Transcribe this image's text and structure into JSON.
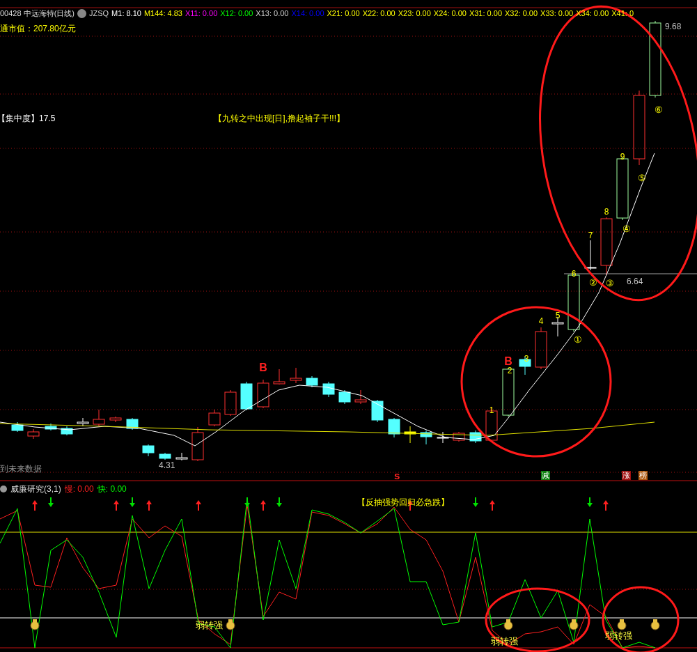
{
  "header": {
    "security": "00428 中远海特(日线)",
    "indicators": [
      {
        "text": "JZSQ",
        "color": "#d0d0d0"
      },
      {
        "text": "M1: 8.10",
        "color": "#ffffff"
      },
      {
        "text": "M144: 4.83",
        "color": "#ffff00"
      },
      {
        "text": "X11: 0.00",
        "color": "#ff00ff"
      },
      {
        "text": "X12: 0.00",
        "color": "#00ff00"
      },
      {
        "text": "X13: 0.00",
        "color": "#d0d0d0"
      },
      {
        "text": "X14: 0.00",
        "color": "#0000ff"
      },
      {
        "text": "X21: 0.00",
        "color": "#ffff00"
      },
      {
        "text": "X22: 0.00",
        "color": "#ffff00"
      },
      {
        "text": "X23: 0.00",
        "color": "#ffff00"
      },
      {
        "text": "X24: 0.00",
        "color": "#ffff00"
      },
      {
        "text": "X31: 0.00",
        "color": "#ffff00"
      },
      {
        "text": "X32: 0.00",
        "color": "#ffff00"
      },
      {
        "text": "X33: 0.00",
        "color": "#ffff00"
      },
      {
        "text": "X34: 0.00",
        "color": "#ffff00"
      },
      {
        "text": "X41: 0",
        "color": "#ffff00"
      }
    ],
    "market_cap": "通市值：207.80亿元"
  },
  "main_chart": {
    "concentration": "【集中度】17.5",
    "signal": "【九转之中出现[日],撸起袖子干!!!】",
    "future_note": "到未来数据",
    "candle_labels": [
      {
        "text": "B",
        "kind": "buy"
      },
      {
        "text": "1",
        "kind": "count"
      },
      {
        "text": "B",
        "kind": "buy"
      },
      {
        "text": "2",
        "kind": "count"
      },
      {
        "text": "3",
        "kind": "count"
      },
      {
        "text": "4",
        "kind": "count"
      },
      {
        "text": "5",
        "kind": "count"
      },
      {
        "text": "6",
        "kind": "count"
      },
      {
        "text": "7",
        "kind": "count"
      },
      {
        "text": "8",
        "kind": "count"
      },
      {
        "text": "9",
        "kind": "count"
      },
      {
        "text": "①",
        "kind": "seq"
      },
      {
        "text": "②",
        "kind": "seq"
      },
      {
        "text": "③",
        "kind": "seq"
      },
      {
        "text": "④",
        "kind": "seq"
      },
      {
        "text": "⑤",
        "kind": "seq"
      },
      {
        "text": "⑥",
        "kind": "seq"
      }
    ],
    "price_labels": [
      "9.68",
      "4.31",
      "6.64"
    ],
    "marks": [
      {
        "text": "s",
        "color": "#ff2020"
      },
      {
        "text": "减",
        "color": "#108010"
      },
      {
        "text": "涨",
        "color": "#a01010"
      },
      {
        "text": "榜",
        "color": "#b05a10"
      }
    ]
  },
  "oscillator": {
    "title": "威廉研究(3,1)",
    "readings": [
      {
        "text": "慢: 0.00",
        "color": "#ff2020"
      },
      {
        "text": "快: 0.00",
        "color": "#00ff00"
      }
    ],
    "signal": "【反抽强势回归必急跌】",
    "arrows": [
      {
        "kind": "up"
      },
      {
        "kind": "down"
      },
      {
        "kind": "up"
      },
      {
        "kind": "down"
      },
      {
        "kind": "up"
      },
      {
        "kind": "up"
      },
      {
        "kind": "down"
      },
      {
        "kind": "up"
      },
      {
        "kind": "down"
      },
      {
        "kind": "up"
      },
      {
        "kind": "down"
      },
      {
        "kind": "up"
      },
      {
        "kind": "down"
      },
      {
        "kind": "up"
      }
    ],
    "labels": [
      "弱转强",
      "弱转强",
      "弱转强"
    ]
  }
}
